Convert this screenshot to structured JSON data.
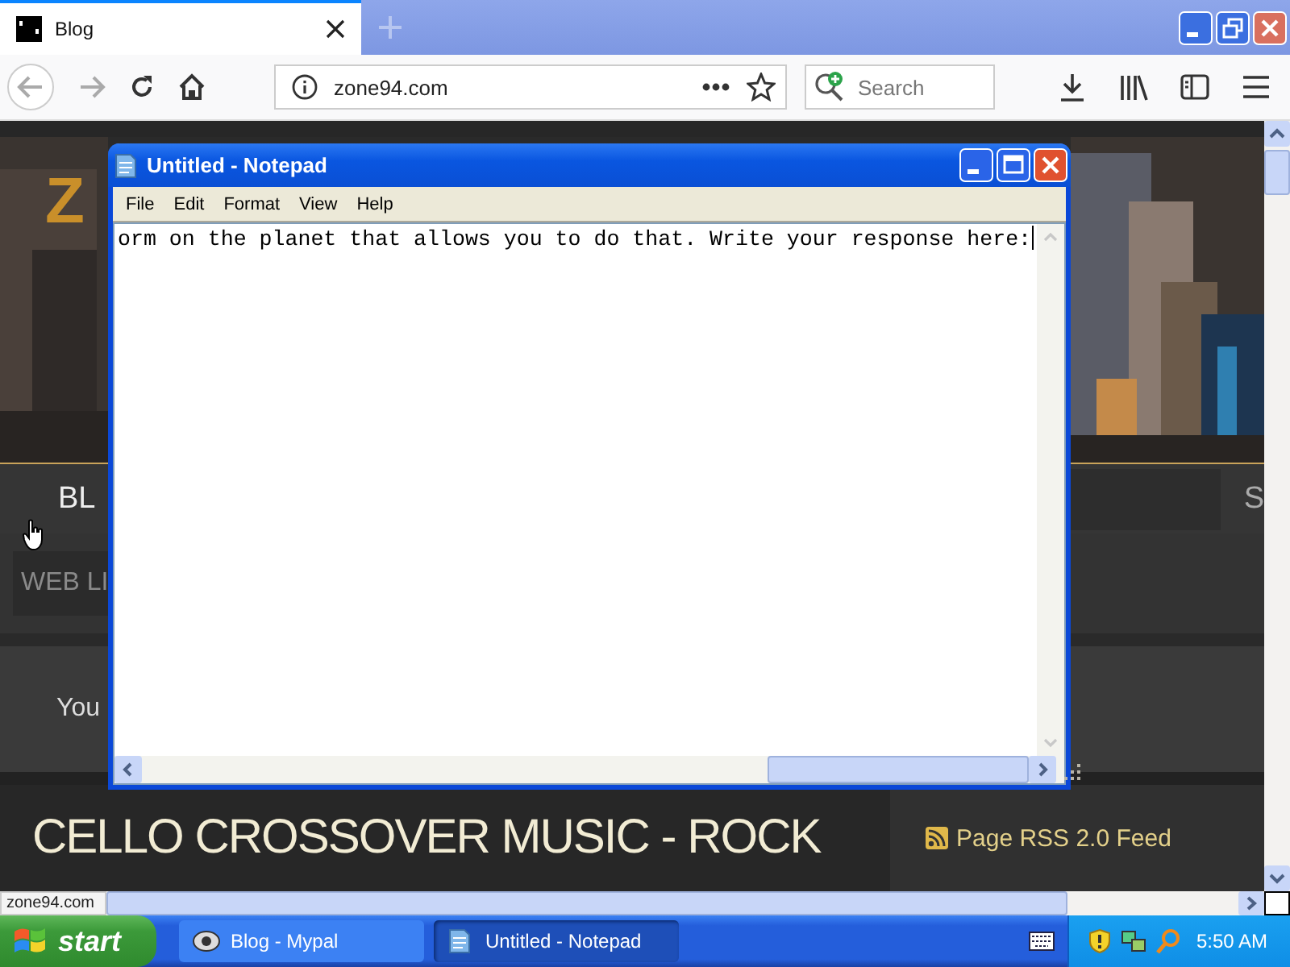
{
  "browser": {
    "tab": {
      "title": "Blog",
      "selected": true
    },
    "address": "zone94.com",
    "search": {
      "placeholder": "Search"
    }
  },
  "page": {
    "logo": "Z",
    "nav": [
      "BL",
      "S"
    ],
    "search": {
      "placeholder": "WEB LI"
    },
    "intro": "You",
    "heading": "CELLO CROSSOVER MUSIC - ROCK",
    "feed": "Page RSS 2.0 Feed"
  },
  "status_bar": "zone94.com",
  "notepad": {
    "title": "Untitled - Notepad",
    "menu": [
      "File",
      "Edit",
      "Format",
      "View",
      "Help"
    ],
    "text": "orm on the planet that allows you to do that. Write your response here:"
  },
  "taskbar": {
    "start": "start",
    "items": [
      {
        "label": "Blog - Mypal",
        "kind": "browser",
        "selected": false
      },
      {
        "label": "Untitled - Notepad",
        "kind": "notepad",
        "selected": true
      }
    ],
    "clock": "5:50 AM"
  }
}
